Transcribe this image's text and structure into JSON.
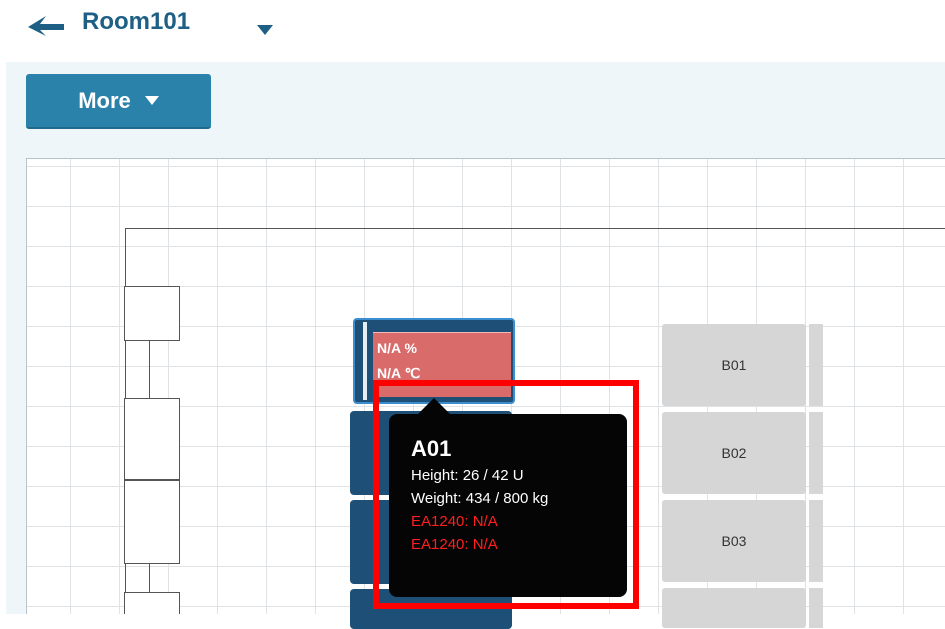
{
  "header": {
    "back_icon": "back-arrow-icon",
    "room_name": "Room101",
    "dropdown_icon": "caret-down-icon"
  },
  "toolbar": {
    "more_label": "More",
    "more_icon": "caret-down-icon",
    "accent_color": "#2a81a9"
  },
  "racks_a": [
    {
      "id": "A01",
      "humidity": "N/A %",
      "temperature": "N/A ℃",
      "status_color": "#d96b6b"
    }
  ],
  "racks_b": [
    {
      "label": "B01"
    },
    {
      "label": "B02"
    },
    {
      "label": "B03"
    }
  ],
  "tooltip": {
    "title": "A01",
    "height": "Height: 26 / 42 U",
    "weight": "Weight: 434 / 800 kg",
    "alerts": [
      "EA1240: N/A",
      "EA1240: N/A"
    ],
    "alert_color": "#ff1f1f"
  }
}
